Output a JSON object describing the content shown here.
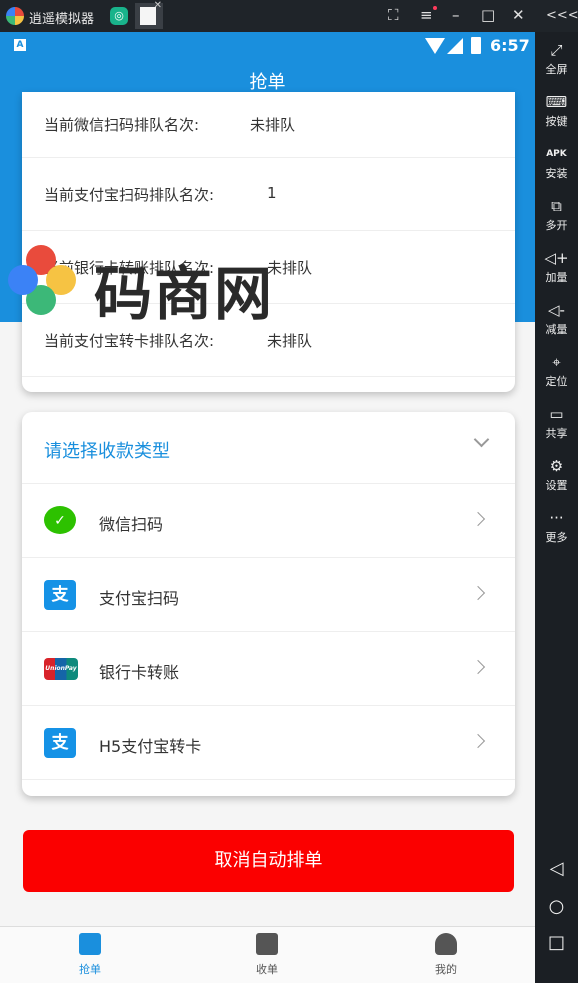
{
  "emulator": {
    "app_name": "逍遥模拟器",
    "controls": [
      "⛶",
      "≡",
      "–",
      "□",
      "✕",
      "<<<"
    ],
    "side_buttons": [
      {
        "icon": "⤢",
        "label": "全屏"
      },
      {
        "icon": "⌨",
        "label": "按键"
      },
      {
        "icon": "APK",
        "label": "安装"
      },
      {
        "icon": "⧉",
        "label": "多开"
      },
      {
        "icon": "◁+",
        "label": "加量"
      },
      {
        "icon": "◁-",
        "label": "减量"
      },
      {
        "icon": "⌖",
        "label": "定位"
      },
      {
        "icon": "▭",
        "label": "共享"
      },
      {
        "icon": "⚙",
        "label": "设置"
      },
      {
        "icon": "···",
        "label": "更多"
      }
    ],
    "nav": [
      "◁",
      "○",
      "□"
    ]
  },
  "status_bar": {
    "time": "6:57",
    "notif_icon": "A"
  },
  "header": {
    "title": "抢单"
  },
  "queue": {
    "rows": [
      {
        "label": "当前微信扫码排队名次:",
        "value": "未排队"
      },
      {
        "label": "当前支付宝扫码排队名次:",
        "value": "1"
      },
      {
        "label": "当前银行卡转账排队名次:",
        "value": "未排队"
      },
      {
        "label": "当前支付宝转卡排队名次:",
        "value": "未排队"
      }
    ]
  },
  "payment": {
    "heading": "请选择收款类型",
    "items": [
      {
        "label": "微信扫码",
        "icon": "wechat-icon",
        "glyph": "✓"
      },
      {
        "label": "支付宝扫码",
        "icon": "alipay-icon",
        "glyph": "支"
      },
      {
        "label": "银行卡转账",
        "icon": "unionpay-icon",
        "glyph": "UnionPay"
      },
      {
        "label": "H5支付宝转卡",
        "icon": "alipay-icon",
        "glyph": "支"
      }
    ]
  },
  "cancel_button": {
    "label": "取消自动排单"
  },
  "tabs": [
    {
      "label": "抢单",
      "active": true
    },
    {
      "label": "收单",
      "active": false
    },
    {
      "label": "我的",
      "active": false
    }
  ],
  "watermark": {
    "text": "码商网"
  },
  "colors": {
    "primary": "#1a8fdd",
    "danger": "#fb0000",
    "wechat": "#2dc100",
    "alipay": "#1592e6"
  }
}
